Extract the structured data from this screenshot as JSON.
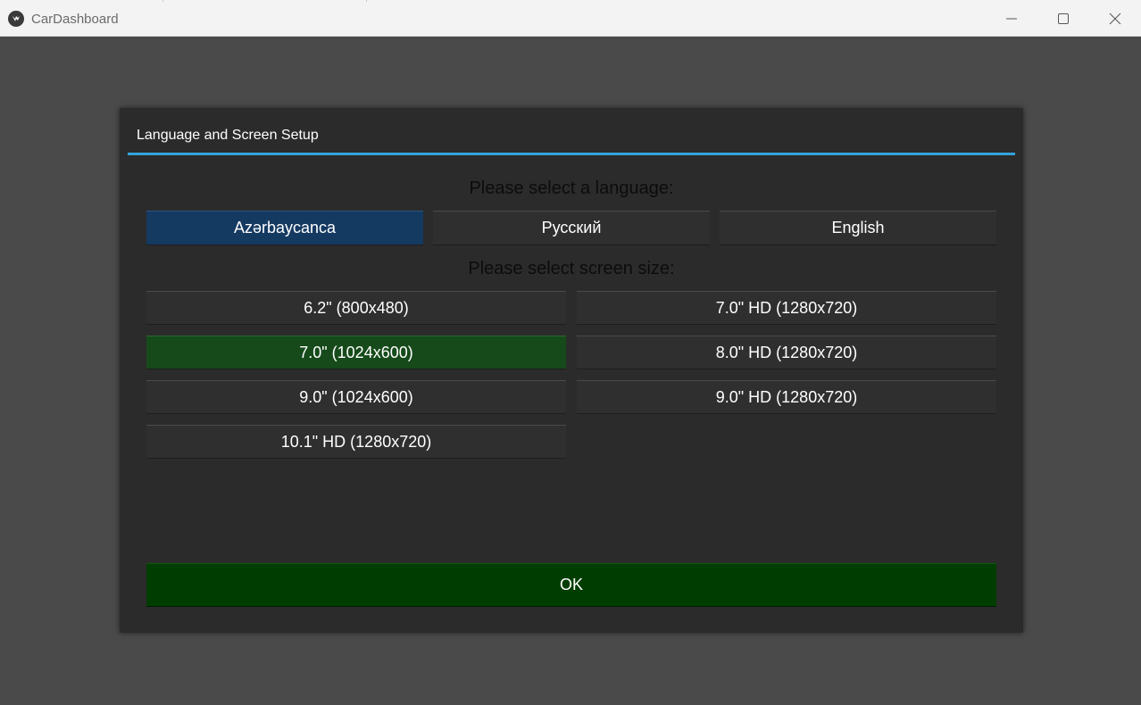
{
  "window": {
    "title": "CarDashboard",
    "controls": {
      "minimize": "minimize-icon",
      "maximize": "maximize-icon",
      "close": "close-icon"
    }
  },
  "dialog": {
    "title": "Language and Screen Setup",
    "accent_color": "#33a3dc",
    "language_prompt": "Please select a language:",
    "languages": [
      {
        "label": "Azərbaycanca",
        "selected": true
      },
      {
        "label": "Русский",
        "selected": false
      },
      {
        "label": "English",
        "selected": false
      }
    ],
    "size_prompt": "Please select screen size:",
    "sizes": [
      {
        "label": "6.2\" (800x480)",
        "selected": false
      },
      {
        "label": "7.0\" HD (1280x720)",
        "selected": false
      },
      {
        "label": "7.0\" (1024x600)",
        "selected": true
      },
      {
        "label": "8.0\" HD (1280x720)",
        "selected": false
      },
      {
        "label": "9.0\" (1024x600)",
        "selected": false
      },
      {
        "label": "9.0\" HD (1280x720)",
        "selected": false
      },
      {
        "label": "10.1\" HD (1280x720)",
        "selected": false
      }
    ],
    "ok_label": "OK",
    "colors": {
      "selected_language": "#153a62",
      "selected_size": "#164a1a",
      "ok_button": "#003d00"
    }
  }
}
